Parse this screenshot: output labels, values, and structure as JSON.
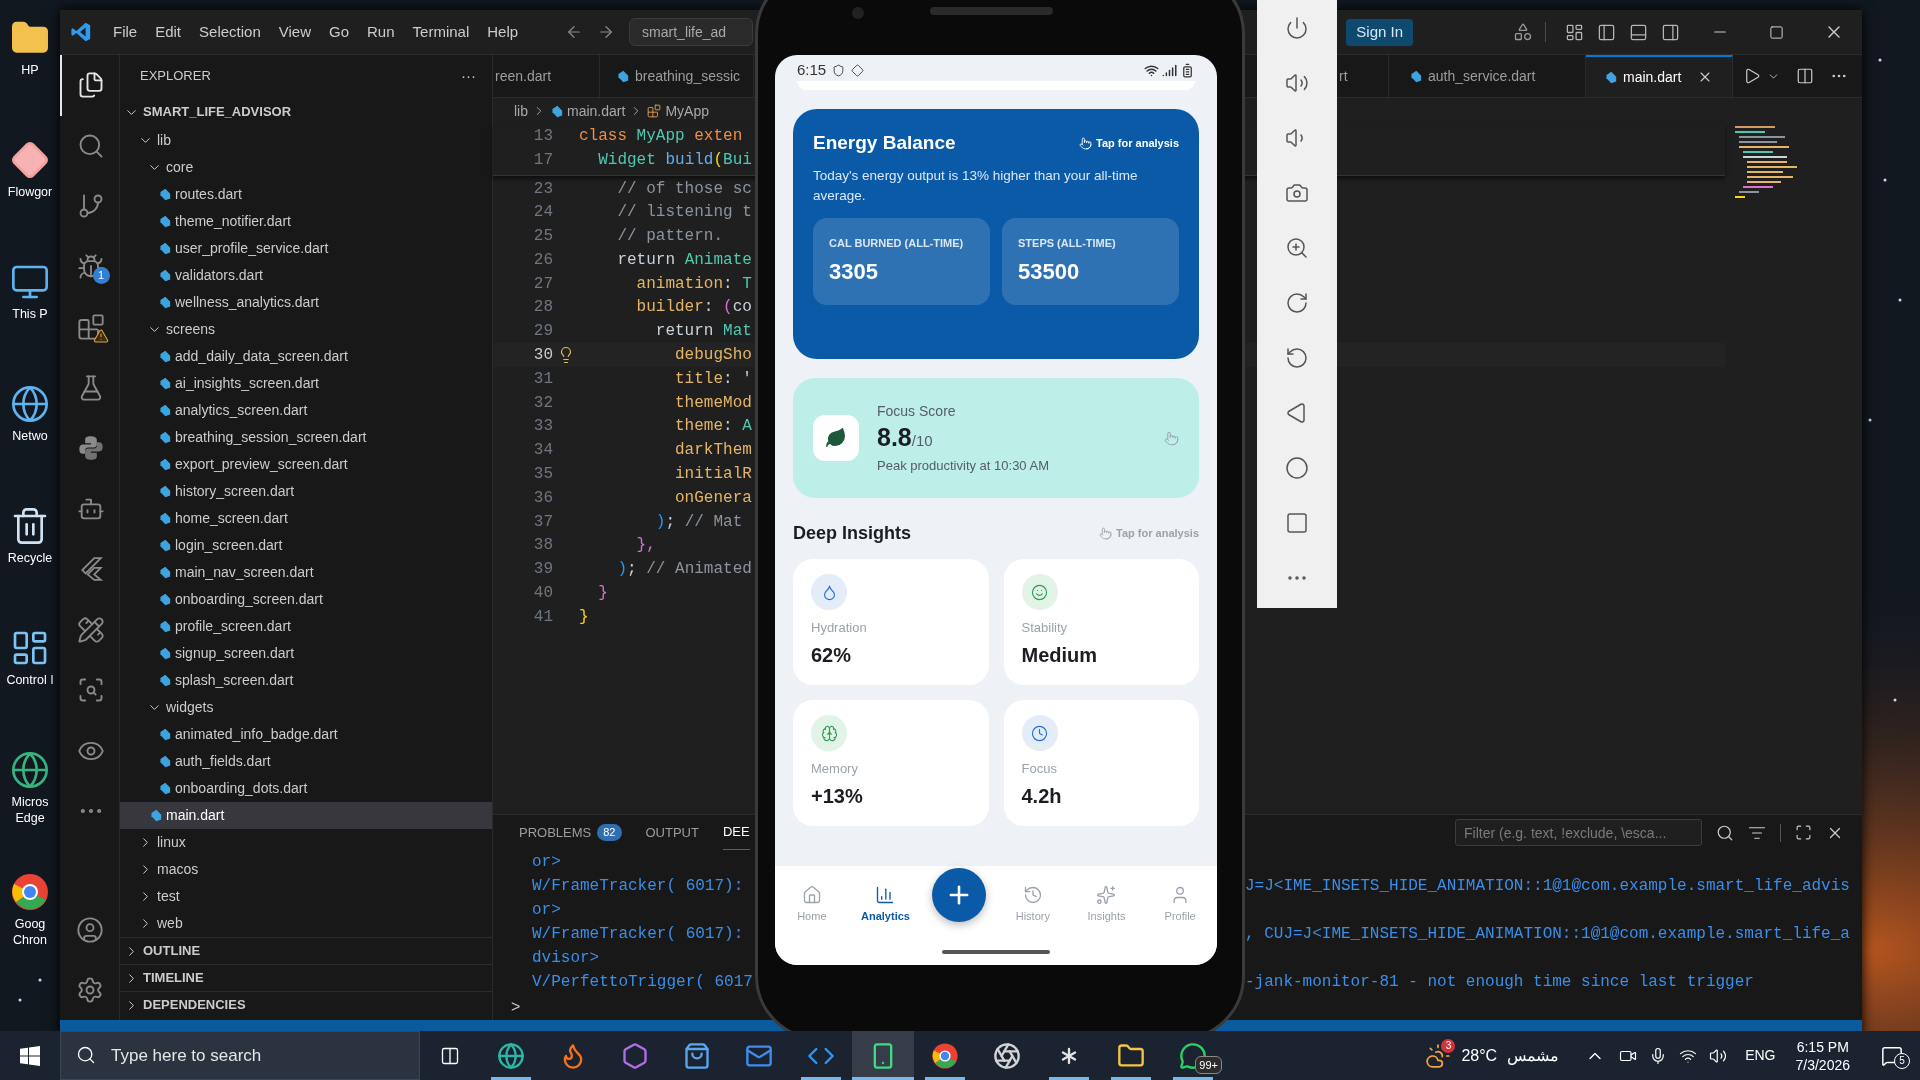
{
  "desktop": {
    "icons": [
      {
        "kind": "user-folder",
        "label": "HP"
      },
      {
        "kind": "diamond",
        "label": "Flowgor"
      },
      {
        "kind": "computer",
        "label": "This P"
      },
      {
        "kind": "network",
        "label": "Netwo"
      },
      {
        "kind": "bin",
        "label": "Recycle"
      },
      {
        "kind": "panel",
        "label": "Control I"
      },
      {
        "kind": "globe",
        "label": "Micros Edge"
      },
      {
        "kind": "ring",
        "label": "Goog Chron"
      }
    ]
  },
  "vscode": {
    "title_bar": {
      "menu": [
        "File",
        "Edit",
        "Selection",
        "View",
        "Go",
        "Run",
        "Terminal",
        "Help"
      ],
      "command_center": "smart_life_ad",
      "sign_in": "Sign In"
    },
    "activity_bar": {
      "items": [
        {
          "kind": "explorer",
          "selected": true
        },
        {
          "kind": "search",
          "selected": false
        },
        {
          "kind": "git",
          "selected": false
        },
        {
          "kind": "debug",
          "selected": false,
          "badge": "1"
        },
        {
          "kind": "extensions",
          "selected": false
        },
        {
          "kind": "testing",
          "selected": false
        },
        {
          "kind": "python",
          "selected": false
        },
        {
          "kind": "robot",
          "selected": false
        },
        {
          "kind": "flutter",
          "selected": false
        },
        {
          "kind": "pencil",
          "selected": false
        },
        {
          "kind": "scan",
          "selected": false
        },
        {
          "kind": "preview",
          "selected": false
        },
        {
          "kind": "more",
          "selected": false
        }
      ],
      "bottom": [
        {
          "kind": "account"
        },
        {
          "kind": "settings"
        }
      ]
    },
    "explorer": {
      "title": "EXPLORER",
      "more": "···",
      "project": "SMART_LIFE_ADVISOR",
      "tree": [
        {
          "kind": "folder",
          "label": "lib",
          "expanded": true,
          "selected": false,
          "children": [
            {
              "kind": "folder",
              "label": "core",
              "expanded": true,
              "selected": false,
              "children": [
                {
                  "kind": "file",
                  "label": "routes.dart",
                  "selected": false
                },
                {
                  "kind": "file",
                  "label": "theme_notifier.dart",
                  "selected": false
                },
                {
                  "kind": "file",
                  "label": "user_profile_service.dart",
                  "selected": false
                },
                {
                  "kind": "file",
                  "label": "validators.dart",
                  "selected": false
                },
                {
                  "kind": "file",
                  "label": "wellness_analytics.dart",
                  "selected": false
                }
              ]
            },
            {
              "kind": "folder",
              "label": "screens",
              "expanded": true,
              "selected": false,
              "children": [
                {
                  "kind": "file",
                  "label": "add_daily_data_screen.dart",
                  "selected": false
                },
                {
                  "kind": "file",
                  "label": "ai_insights_screen.dart",
                  "selected": false
                },
                {
                  "kind": "file",
                  "label": "analytics_screen.dart",
                  "selected": false
                },
                {
                  "kind": "file",
                  "label": "breathing_session_screen.dart",
                  "selected": false
                },
                {
                  "kind": "file",
                  "label": "export_preview_screen.dart",
                  "selected": false
                },
                {
                  "kind": "file",
                  "label": "history_screen.dart",
                  "selected": false
                },
                {
                  "kind": "file",
                  "label": "home_screen.dart",
                  "selected": false
                },
                {
                  "kind": "file",
                  "label": "login_screen.dart",
                  "selected": false
                },
                {
                  "kind": "file",
                  "label": "main_nav_screen.dart",
                  "selected": false
                },
                {
                  "kind": "file",
                  "label": "onboarding_screen.dart",
                  "selected": false
                },
                {
                  "kind": "file",
                  "label": "profile_screen.dart",
                  "selected": false
                },
                {
                  "kind": "file",
                  "label": "signup_screen.dart",
                  "selected": false
                },
                {
                  "kind": "file",
                  "label": "splash_screen.dart",
                  "selected": false
                }
              ]
            },
            {
              "kind": "folder",
              "label": "widgets",
              "expanded": true,
              "selected": false,
              "children": [
                {
                  "kind": "file",
                  "label": "animated_info_badge.dart",
                  "selected": false
                },
                {
                  "kind": "file",
                  "label": "auth_fields.dart",
                  "selected": false
                },
                {
                  "kind": "file",
                  "label": "onboarding_dots.dart",
                  "selected": false
                }
              ]
            },
            {
              "kind": "file",
              "label": "main.dart",
              "selected": true
            }
          ]
        },
        {
          "kind": "folder",
          "label": "linux",
          "expanded": false,
          "selected": false
        },
        {
          "kind": "folder",
          "label": "macos",
          "expanded": false,
          "selected": false
        },
        {
          "kind": "folder",
          "label": "test",
          "expanded": false,
          "selected": false
        },
        {
          "kind": "folder",
          "label": "web",
          "expanded": false,
          "selected": false
        }
      ],
      "sections": [
        {
          "label": "OUTLINE",
          "expanded": false
        },
        {
          "label": "TIMELINE",
          "expanded": false
        },
        {
          "label": "DEPENDENCIES",
          "expanded": false
        }
      ]
    },
    "tabs_left": [
      {
        "label": "reen.dart",
        "selected": false,
        "cut": true
      },
      {
        "label": "breathing_sessic",
        "selected": false,
        "cut": false
      }
    ],
    "tabs_right": [
      {
        "label": "rt",
        "selected": false,
        "cut": true
      },
      {
        "label": "auth_service.dart",
        "selected": false,
        "cut": false
      },
      {
        "label": "main.dart",
        "selected": true,
        "cut": false
      }
    ],
    "breadcrumb": [
      "lib",
      "main.dart",
      "MyApp"
    ],
    "sticky_lines": [
      {
        "number": "13",
        "current": false,
        "segments": [
          {
            "color": "#f08d49",
            "text": "class "
          },
          {
            "color": "#4ec9b0",
            "text": "MyApp "
          },
          {
            "color": "#f08d49",
            "text": "exten"
          }
        ]
      },
      {
        "number": "17",
        "current": false,
        "segments": [
          {
            "color": "#4ec9b0",
            "text": "  Widget "
          },
          {
            "color": "#61afef",
            "text": "build"
          },
          {
            "color": "#ffd700",
            "text": "("
          },
          {
            "color": "#4ec9b0",
            "text": "Bui"
          }
        ]
      }
    ],
    "lines": [
      {
        "number": "23",
        "current": false,
        "segments": [
          {
            "color": "#8b949e",
            "text": "    // of those sc"
          }
        ]
      },
      {
        "number": "24",
        "current": false,
        "segments": [
          {
            "color": "#8b949e",
            "text": "    // listening t"
          }
        ]
      },
      {
        "number": "25",
        "current": false,
        "segments": [
          {
            "color": "#8b949e",
            "text": "    // pattern."
          }
        ]
      },
      {
        "number": "26",
        "current": false,
        "segments": [
          {
            "color": "#c9d1d9",
            "text": "    return "
          },
          {
            "color": "#4ec9b0",
            "text": "Animate"
          }
        ]
      },
      {
        "number": "27",
        "current": false,
        "segments": [
          {
            "color": "#e5b567",
            "text": "      animation"
          },
          {
            "color": "#c9d1d9",
            "text": ": "
          },
          {
            "color": "#4ec9b0",
            "text": "T"
          }
        ]
      },
      {
        "number": "28",
        "current": false,
        "segments": [
          {
            "color": "#e5b567",
            "text": "      builder"
          },
          {
            "color": "#c9d1d9",
            "text": ": "
          },
          {
            "color": "#da70d6",
            "text": "("
          },
          {
            "color": "#c9d1d9",
            "text": "co"
          }
        ]
      },
      {
        "number": "29",
        "current": false,
        "segments": [
          {
            "color": "#c9d1d9",
            "text": "        return "
          },
          {
            "color": "#4ec9b0",
            "text": "Mat"
          }
        ]
      },
      {
        "number": "30",
        "current": true,
        "segments": [
          {
            "color": "#e5b567",
            "text": "          debugSho"
          }
        ]
      },
      {
        "number": "31",
        "current": false,
        "segments": [
          {
            "color": "#e5b567",
            "text": "          title"
          },
          {
            "color": "#c9d1d9",
            "text": ": '"
          }
        ]
      },
      {
        "number": "32",
        "current": false,
        "segments": [
          {
            "color": "#e5b567",
            "text": "          themeMod"
          }
        ]
      },
      {
        "number": "33",
        "current": false,
        "segments": [
          {
            "color": "#e5b567",
            "text": "          theme"
          },
          {
            "color": "#c9d1d9",
            "text": ": "
          },
          {
            "color": "#4ec9b0",
            "text": "A"
          }
        ]
      },
      {
        "number": "34",
        "current": false,
        "segments": [
          {
            "color": "#e5b567",
            "text": "          darkThem"
          }
        ]
      },
      {
        "number": "35",
        "current": false,
        "segments": [
          {
            "color": "#e5b567",
            "text": "          initialR"
          }
        ]
      },
      {
        "number": "36",
        "current": false,
        "segments": [
          {
            "color": "#e5b567",
            "text": "          onGenera"
          }
        ]
      },
      {
        "number": "37",
        "current": false,
        "segments": [
          {
            "color": "#179fff",
            "text": "        )"
          },
          {
            "color": "#c9d1d9",
            "text": "; "
          },
          {
            "color": "#8b949e",
            "text": "// Mat"
          }
        ]
      },
      {
        "number": "38",
        "current": false,
        "segments": [
          {
            "color": "#da70d6",
            "text": "      },"
          }
        ]
      },
      {
        "number": "39",
        "current": false,
        "segments": [
          {
            "color": "#179fff",
            "text": "    )"
          },
          {
            "color": "#c9d1d9",
            "text": "; "
          },
          {
            "color": "#8b949e",
            "text": "// Animated"
          }
        ]
      },
      {
        "number": "40",
        "current": false,
        "segments": [
          {
            "color": "#da70d6",
            "text": "  }"
          }
        ]
      },
      {
        "number": "41",
        "current": false,
        "segments": [
          {
            "color": "#ffd700",
            "text": "}"
          }
        ]
      }
    ],
    "panel": {
      "tabs": [
        {
          "label": "PROBLEMS",
          "badge": "82",
          "selected": false
        },
        {
          "label": "OUTPUT",
          "selected": false
        },
        {
          "label": "DEE",
          "selected": true
        }
      ],
      "filter_placeholder": "Filter (e.g. text, !exclude, \\esca...",
      "log": [
        {
          "left": "or>"
        },
        {
          "left": "W/FrameTracker( 6017):",
          "right": "J=J<IME_INSETS_HIDE_ANIMATION::1@1@com.example.smart_life_advis"
        },
        {
          "left": "or>"
        },
        {
          "left": "W/FrameTracker( 6017):",
          "right": ", CUJ=J<IME_INSETS_HIDE_ANIMATION::1@1@com.example.smart_life_a"
        },
        {
          "left": "dvisor>"
        },
        {
          "left": "V/PerfettoTrigger( 6017",
          "right": "-jank-monitor-81 - not enough time since last trigger"
        }
      ],
      "prompt": ">"
    }
  },
  "phone": {
    "status_bar": {
      "time": "6:15"
    },
    "energy_card": {
      "title": "Energy Balance",
      "hint": "Tap for analysis",
      "description": "Today's energy output is 13% higher than your all-time average.",
      "stats": [
        {
          "label": "CAL BURNED (ALL-TIME)",
          "value": "3305"
        },
        {
          "label": "STEPS (ALL-TIME)",
          "value": "53500"
        }
      ]
    },
    "focus_card": {
      "label": "Focus Score",
      "value": "8.8",
      "scale": "/10",
      "caption": "Peak productivity at 10:30 AM"
    },
    "insights": {
      "title": "Deep Insights",
      "hint": "Tap for analysis",
      "items": [
        {
          "kind": "hydration",
          "label": "Hydration",
          "value": "62%"
        },
        {
          "kind": "stability",
          "label": "Stability",
          "value": "Medium"
        },
        {
          "kind": "memory",
          "label": "Memory",
          "value": "+13%"
        },
        {
          "kind": "focus",
          "label": "Focus",
          "value": "4.2h"
        }
      ]
    },
    "nav": [
      {
        "kind": "home",
        "label": "Home",
        "selected": false
      },
      {
        "kind": "analytics",
        "label": "Analytics",
        "selected": true
      },
      {
        "kind": "add"
      },
      {
        "kind": "history",
        "label": "History",
        "selected": false
      },
      {
        "kind": "insights",
        "label": "Insights",
        "selected": false
      },
      {
        "kind": "profile",
        "label": "Profile",
        "selected": false
      }
    ]
  },
  "taskbar": {
    "search_placeholder": "Type here to search",
    "apps": [
      {
        "kind": "browser",
        "running": true,
        "selected": false
      },
      {
        "kind": "fox",
        "running": false,
        "selected": false
      },
      {
        "kind": "suite",
        "running": false,
        "selected": false
      },
      {
        "kind": "store",
        "running": false,
        "selected": false
      },
      {
        "kind": "mail",
        "running": false,
        "selected": false
      },
      {
        "kind": "editor",
        "running": true,
        "selected": false
      },
      {
        "kind": "phone",
        "running": true,
        "selected": true
      },
      {
        "kind": "ring",
        "running": true,
        "selected": false
      },
      {
        "kind": "aperture",
        "running": false,
        "selected": false
      },
      {
        "kind": "chat",
        "running": true,
        "selected": false
      },
      {
        "kind": "folder",
        "running": true,
        "selected": false
      },
      {
        "kind": "messenger",
        "running": true,
        "selected": false,
        "badge": "99+"
      }
    ],
    "weather": {
      "badge": "3",
      "temperature": "28°C",
      "condition": "مشمس"
    },
    "language": "ENG",
    "time": "6:15 PM",
    "date": "7/3/2026",
    "notifications": "5"
  }
}
